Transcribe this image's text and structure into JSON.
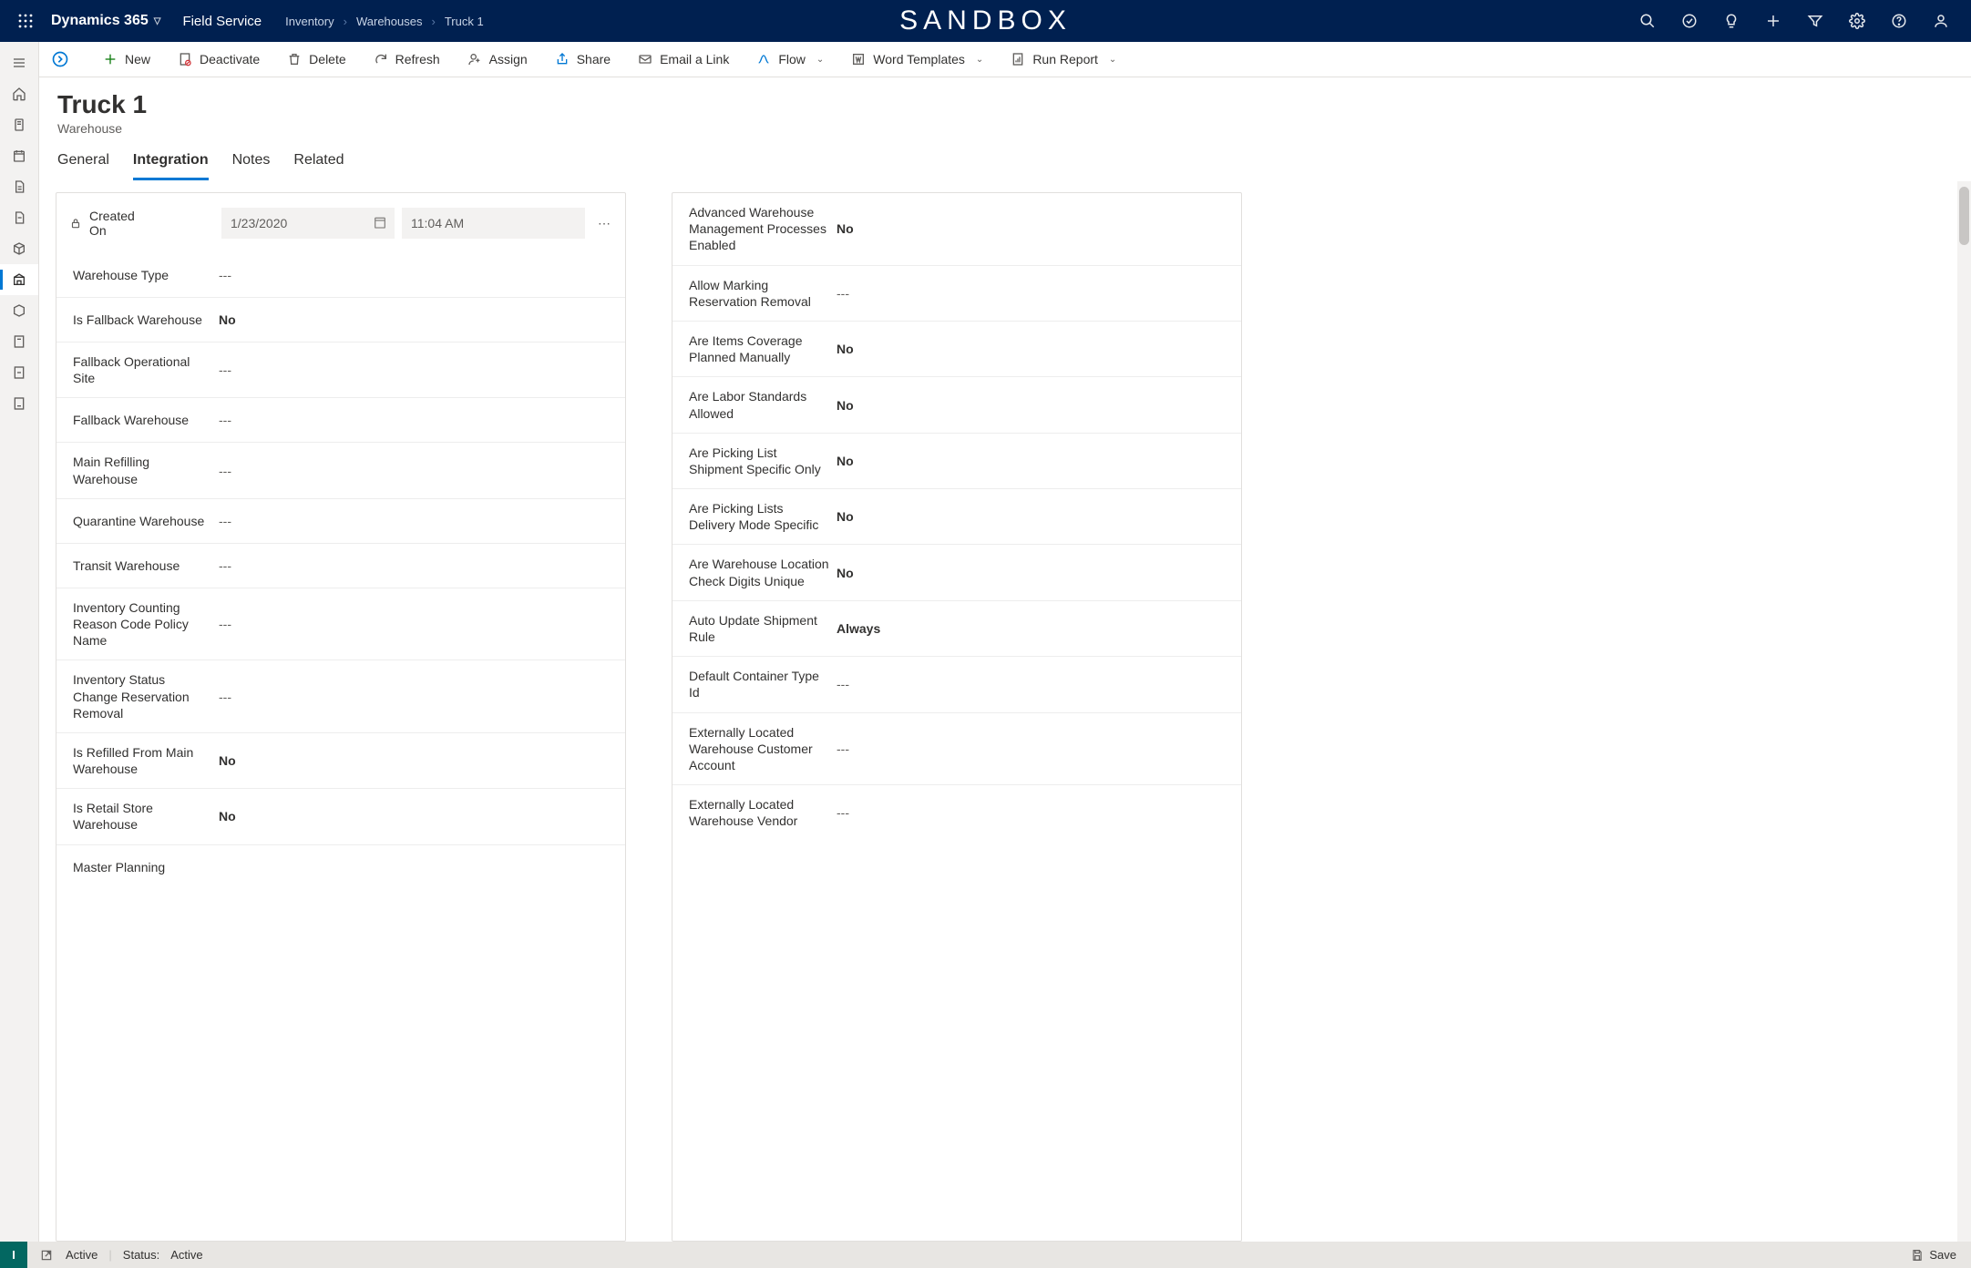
{
  "header": {
    "brand": "Dynamics 365",
    "module": "Field Service",
    "breadcrumbs": [
      "Inventory",
      "Warehouses",
      "Truck 1"
    ],
    "environment": "SANDBOX"
  },
  "commands": {
    "new": "New",
    "deactivate": "Deactivate",
    "delete": "Delete",
    "refresh": "Refresh",
    "assign": "Assign",
    "share": "Share",
    "email_link": "Email a Link",
    "flow": "Flow",
    "word_templates": "Word Templates",
    "run_report": "Run Report"
  },
  "record": {
    "title": "Truck 1",
    "subtitle": "Warehouse"
  },
  "tabs": [
    "General",
    "Integration",
    "Notes",
    "Related"
  ],
  "active_tab": "Integration",
  "created": {
    "label": "Created On",
    "date": "1/23/2020",
    "time": "11:04 AM"
  },
  "left_fields": [
    {
      "label": "Warehouse Type",
      "value": "---",
      "bold": false
    },
    {
      "label": "Is Fallback Warehouse",
      "value": "No",
      "bold": true
    },
    {
      "label": "Fallback Operational Site",
      "value": "---",
      "bold": false
    },
    {
      "label": "Fallback Warehouse",
      "value": "---",
      "bold": false
    },
    {
      "label": "Main Refilling Warehouse",
      "value": "---",
      "bold": false
    },
    {
      "label": "Quarantine Warehouse",
      "value": "---",
      "bold": false
    },
    {
      "label": "Transit Warehouse",
      "value": "---",
      "bold": false
    },
    {
      "label": "Inventory Counting Reason Code Policy Name",
      "value": "---",
      "bold": false
    },
    {
      "label": "Inventory Status Change Reservation Removal",
      "value": "---",
      "bold": false
    },
    {
      "label": "Is Refilled From Main Warehouse",
      "value": "No",
      "bold": true
    },
    {
      "label": "Is Retail Store Warehouse",
      "value": "No",
      "bold": true
    },
    {
      "label": "Master Planning",
      "value": "",
      "bold": false
    }
  ],
  "right_fields": [
    {
      "label": "Advanced Warehouse Management Processes Enabled",
      "value": "No",
      "bold": true
    },
    {
      "label": "Allow Marking Reservation Removal",
      "value": "---",
      "bold": false
    },
    {
      "label": "Are Items Coverage Planned Manually",
      "value": "No",
      "bold": true
    },
    {
      "label": "Are Labor Standards Allowed",
      "value": "No",
      "bold": true
    },
    {
      "label": "Are Picking List Shipment Specific Only",
      "value": "No",
      "bold": true
    },
    {
      "label": "Are Picking Lists Delivery Mode Specific",
      "value": "No",
      "bold": true
    },
    {
      "label": "Are Warehouse Location Check Digits Unique",
      "value": "No",
      "bold": true
    },
    {
      "label": "Auto Update Shipment Rule",
      "value": "Always",
      "bold": true
    },
    {
      "label": "Default Container Type Id",
      "value": "---",
      "bold": false
    },
    {
      "label": "Externally Located Warehouse Customer Account",
      "value": "---",
      "bold": false
    },
    {
      "label": "Externally Located Warehouse Vendor",
      "value": "---",
      "bold": false
    }
  ],
  "footer": {
    "state": "Active",
    "status_label": "Status:",
    "status_value": "Active",
    "save": "Save"
  }
}
